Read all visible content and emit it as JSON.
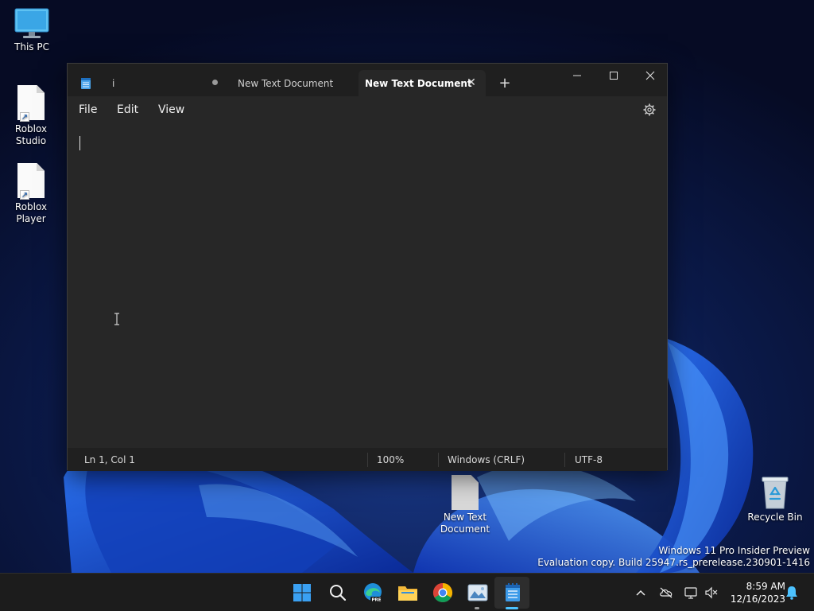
{
  "desktop": {
    "icons": [
      {
        "label": "This PC",
        "icon": "monitor-icon"
      },
      {
        "label": "Roblox Studio",
        "icon": "document-shortcut-icon"
      },
      {
        "label": "Roblox Player",
        "icon": "document-shortcut-icon"
      },
      {
        "label": "New Text Document",
        "icon": "text-document-icon"
      },
      {
        "label": "Recycle Bin",
        "icon": "recycle-bin-icon"
      }
    ],
    "watermark": {
      "line1": "Windows 11 Pro Insider Preview",
      "line2": "Evaluation copy. Build 25947.rs_prerelease.230901-1416"
    }
  },
  "notepad": {
    "tabs": [
      {
        "label": "i",
        "active": false
      },
      {
        "label": "New Text Document",
        "active": false,
        "unsaved": true
      },
      {
        "label": "New Text Document",
        "active": true
      }
    ],
    "window_controls": {
      "minimize": "–",
      "maximize": "☐",
      "close": "✕"
    },
    "new_tab_label": "+",
    "menu": {
      "file": "File",
      "edit": "Edit",
      "view": "View"
    },
    "editor_text": "",
    "status": {
      "position": "Ln 1, Col 1",
      "zoom": "100%",
      "line_ending": "Windows (CRLF)",
      "encoding": "UTF-8"
    }
  },
  "taskbar": {
    "apps": [
      "start-icon",
      "search-icon",
      "edge-icon",
      "file-explorer-icon",
      "chrome-icon",
      "photos-icon",
      "notepad-icon"
    ],
    "tray": [
      "chevron-up-icon",
      "onedrive-icon",
      "network-icon",
      "volume-icon",
      "notification-icon"
    ],
    "time": "8:59 AM",
    "date": "12/16/2023"
  },
  "colors": {
    "window_bg": "#272727",
    "titlebar_bg": "#1f1f1f",
    "accent": "#4cc2ff",
    "taskbar_bg": "#1c1c1c"
  }
}
